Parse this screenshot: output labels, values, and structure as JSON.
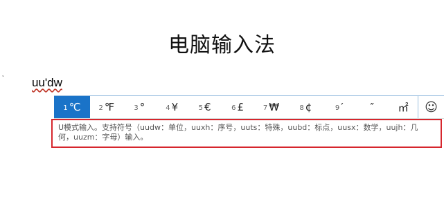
{
  "document": {
    "title": "电脑输入法",
    "left_marker": "ˇ",
    "composition_text": "uu'dw"
  },
  "candidate_bar": {
    "candidates": [
      {
        "index": "1",
        "symbol": "℃",
        "selected": true
      },
      {
        "index": "2",
        "symbol": "℉",
        "selected": false
      },
      {
        "index": "3",
        "symbol": "°",
        "selected": false
      },
      {
        "index": "4",
        "symbol": "¥",
        "selected": false
      },
      {
        "index": "5",
        "symbol": "€",
        "selected": false
      },
      {
        "index": "6",
        "symbol": "£",
        "selected": false
      },
      {
        "index": "7",
        "symbol": "₩",
        "selected": false
      },
      {
        "index": "8",
        "symbol": "¢",
        "selected": false
      },
      {
        "index": "9",
        "symbol": "′",
        "selected": false
      },
      {
        "index": "",
        "symbol": "″",
        "selected": false
      },
      {
        "index": "",
        "symbol": "㎡",
        "selected": false
      }
    ],
    "emoji_button": "☺"
  },
  "hint": {
    "line1": "U模式输入。支持符号（uudw：单位，uuxh：序号，uuts：特殊，uubd：标点，uusx：数学，uujh：几",
    "line2": "何，uuzm：字母）输入。"
  },
  "colors": {
    "selected_bg": "#1a73c8",
    "hint_border": "#d6262d",
    "underline": "#c0392b"
  }
}
